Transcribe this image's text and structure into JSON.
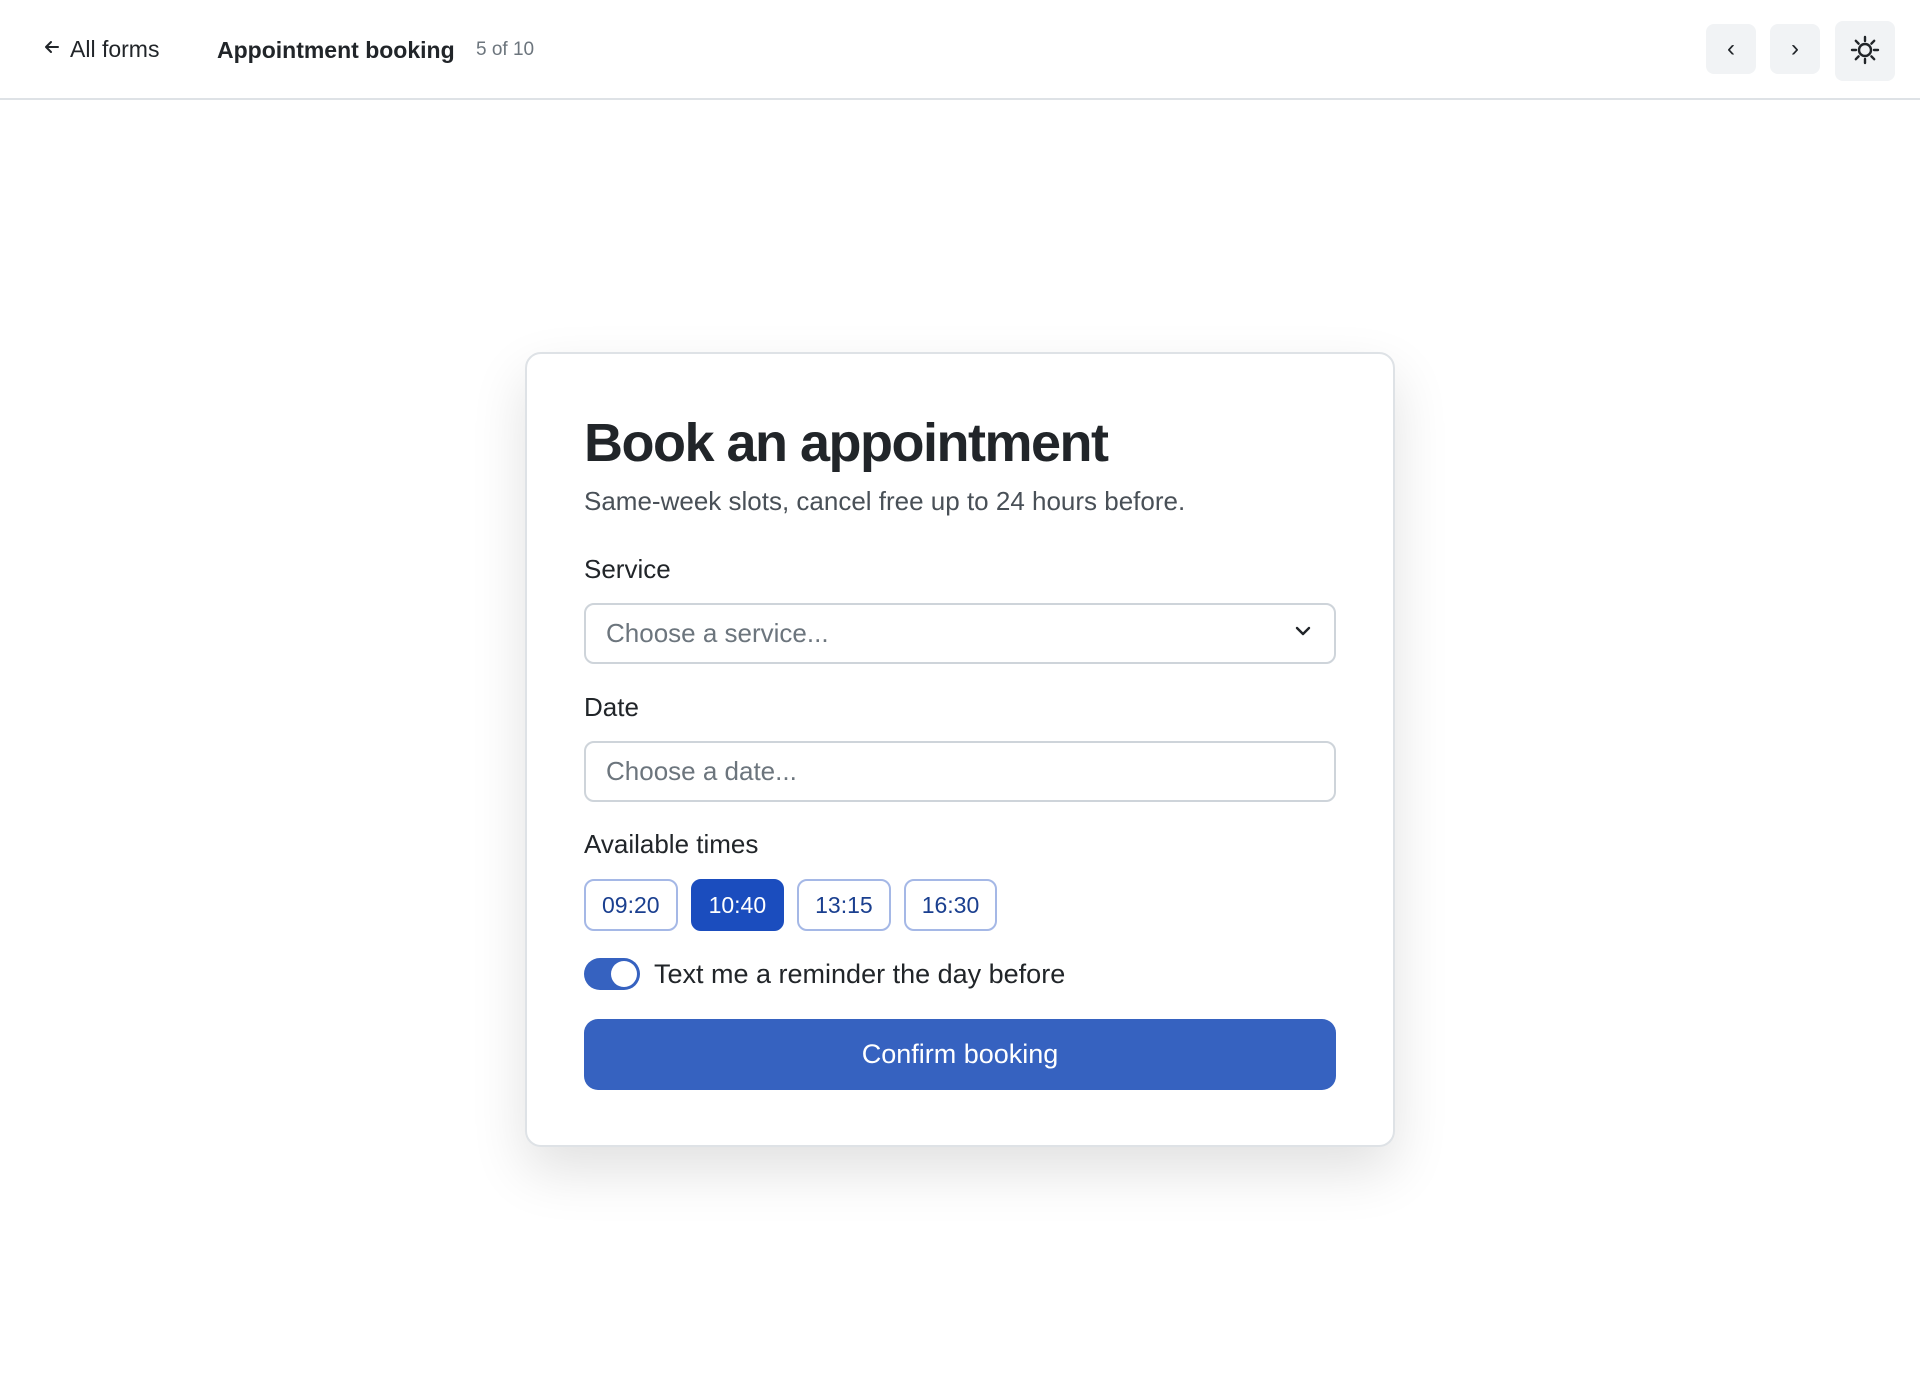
{
  "topbar": {
    "back_label": "All forms",
    "title": "Appointment booking",
    "position": "5 of 10",
    "prev_label": "‹",
    "next_label": "›"
  },
  "form": {
    "title": "Book an appointment",
    "subtitle": "Same-week slots, cancel free up to 24 hours before.",
    "service": {
      "label": "Service",
      "placeholder": "Choose a service..."
    },
    "date": {
      "label": "Date",
      "placeholder": "Choose a date..."
    },
    "times": {
      "label": "Available times",
      "slots": [
        {
          "label": "09:20",
          "selected": false
        },
        {
          "label": "10:40",
          "selected": true
        },
        {
          "label": "13:15",
          "selected": false
        },
        {
          "label": "16:30",
          "selected": false
        }
      ]
    },
    "reminder": {
      "label": "Text me a reminder the day before",
      "enabled": true
    },
    "submit_label": "Confirm booking"
  },
  "colors": {
    "primary": "#3662c0",
    "selected_chip": "#1b4dbe",
    "chip_text": "#1a3f8f"
  },
  "icons": {
    "back": "arrow-left-icon",
    "select": "chevron-down-icon",
    "theme": "sun-icon"
  }
}
